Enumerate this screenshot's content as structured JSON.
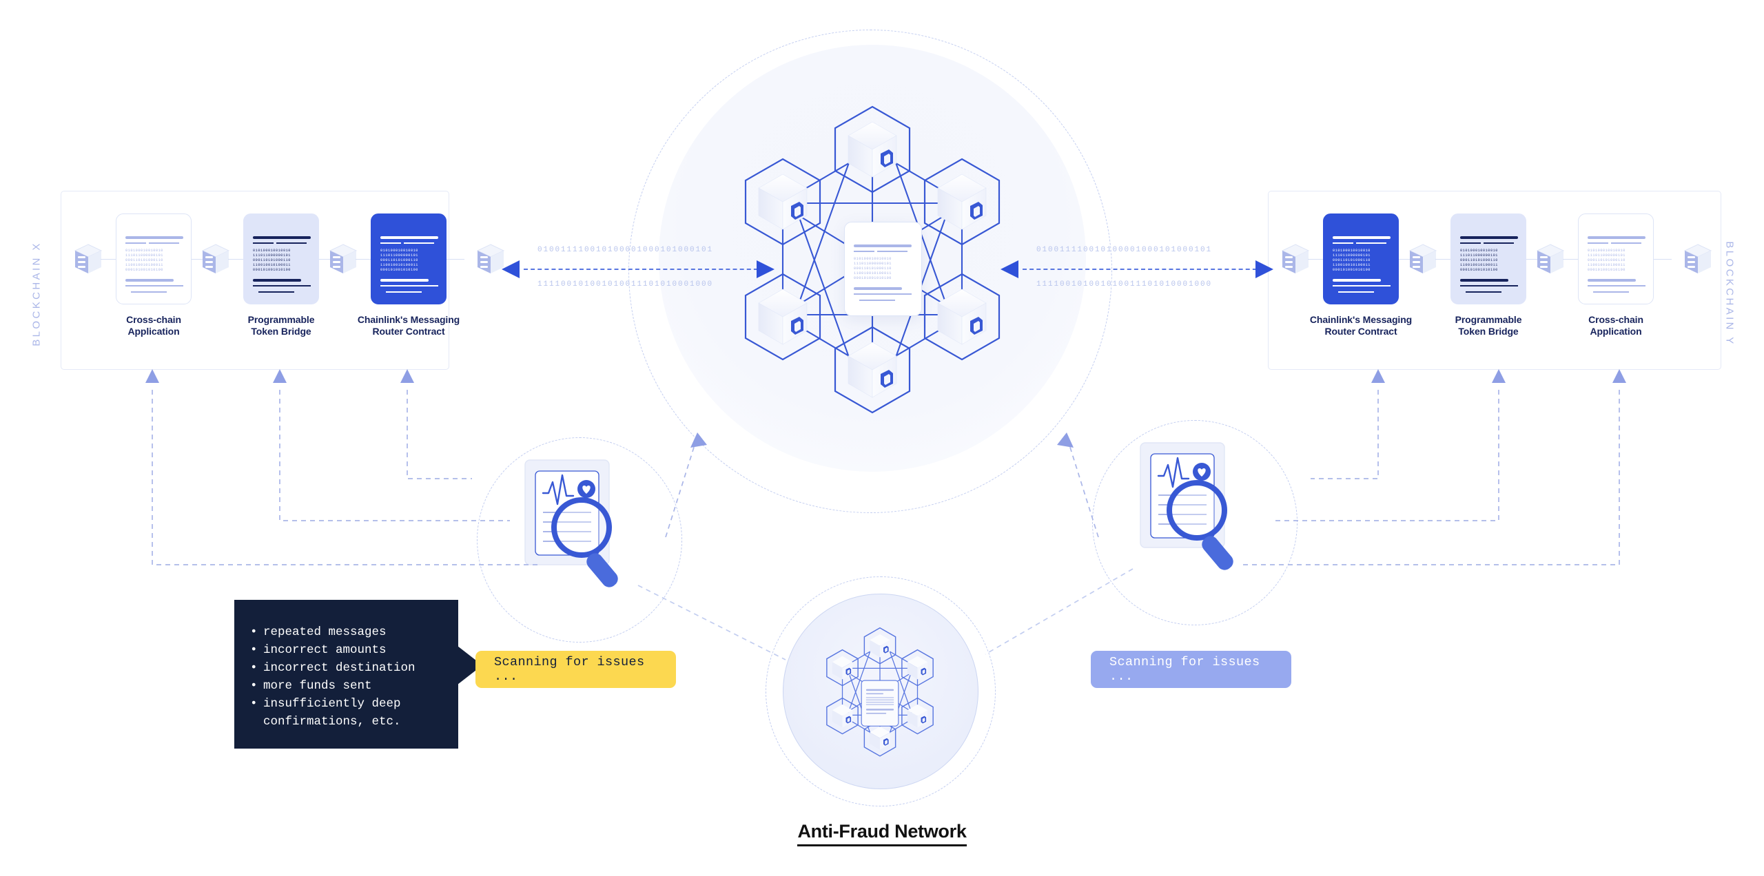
{
  "title": "Anti-Fraud Network",
  "chains": {
    "left_label": "BLOCKCHAIN X",
    "right_label": "BLOCKCHAIN Y"
  },
  "colors": {
    "brand_blue": "#2f51d9",
    "accent_blue": "#5876e0",
    "light_blue": "#aab6e8",
    "tint_blue": "#dfe5f9",
    "navy": "#17235c",
    "tooltip_bg": "#131f3a",
    "badge_yellow": "#fcd850",
    "badge_blue": "#97a9ef",
    "panel_border": "#e4e9f7"
  },
  "left_panel": {
    "nodes": [
      {
        "label_line1": "Cross-chain",
        "label_line2": "Application",
        "style": "outline"
      },
      {
        "label_line1": "Programmable",
        "label_line2": "Token Bridge",
        "style": "tint"
      },
      {
        "label_line1": "Chainlink's Messaging",
        "label_line2": "Router Contract",
        "style": "solid"
      }
    ]
  },
  "right_panel": {
    "nodes": [
      {
        "label_line1": "Chainlink's Messaging",
        "label_line2": "Router Contract",
        "style": "solid"
      },
      {
        "label_line1": "Programmable",
        "label_line2": "Token Bridge",
        "style": "tint"
      },
      {
        "label_line1": "Cross-chain",
        "label_line2": "Application",
        "style": "outline"
      }
    ]
  },
  "card_code": {
    "tag": "</>",
    "binary_lines": [
      "010100010010010",
      "111011000000101",
      "000110101000110",
      "110010010100011",
      "000101001010100"
    ]
  },
  "binary_flow": {
    "left": {
      "top": "010011110010100001000101000101",
      "bottom": "111100101001010011101010001000"
    },
    "right": {
      "top": "010011110010100001000101000101",
      "bottom": "111100101001010011101010001000"
    }
  },
  "tooltip": {
    "items": [
      "repeated messages",
      "incorrect amounts",
      "incorrect destination",
      "more funds sent",
      "insufficiently deep\nconfirmations, etc."
    ]
  },
  "badges": {
    "left_scanning": "Scanning for issues ...",
    "right_scanning": "Scanning for issues ..."
  },
  "icons": {
    "code_tag": "</>",
    "server": "server-stack-icon",
    "magnifier": "magnifier-icon",
    "health_report": "health-report-icon",
    "heart": "heart-icon",
    "cube_node": "blockchain-cube-icon"
  }
}
